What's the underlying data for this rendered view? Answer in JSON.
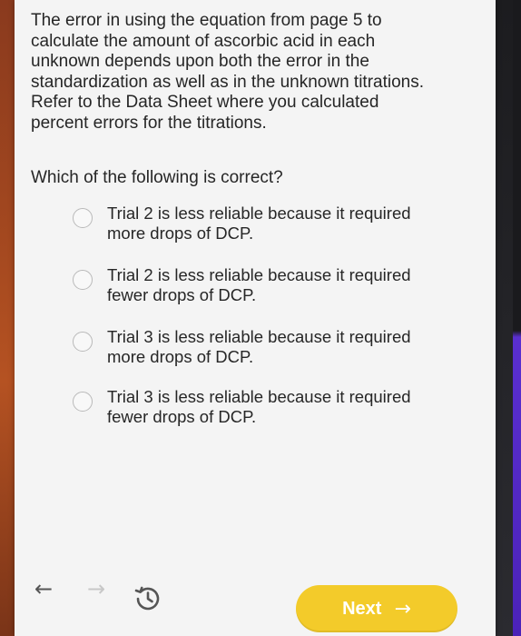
{
  "question": {
    "intro": "The error in using the equation from page 5 to\ncalculate the amount of ascorbic acid in each\nunknown depends upon both the error in the\nstandardization as well as in the unknown titrations.\nRefer to the Data Sheet where you calculated\npercent errors for the titrations.",
    "prompt": "Which of the following is correct?"
  },
  "options": [
    {
      "text": "Trial 2 is less reliable because it required\nmore drops of DCP."
    },
    {
      "text": "Trial 2 is less reliable because it required\nfewer drops of DCP."
    },
    {
      "text": "Trial 3 is less reliable because it required\nmore drops of DCP."
    },
    {
      "text": "Trial 3 is less reliable because it required\nfewer drops of DCP."
    }
  ],
  "nav": {
    "back_icon": "←",
    "forward_icon": "→",
    "history_icon": "history-icon",
    "next_label": "Next",
    "next_arrow": "→"
  },
  "colors": {
    "next_button": "#f3cb2a",
    "page_background": "#f4f4f4",
    "text": "#262626"
  }
}
